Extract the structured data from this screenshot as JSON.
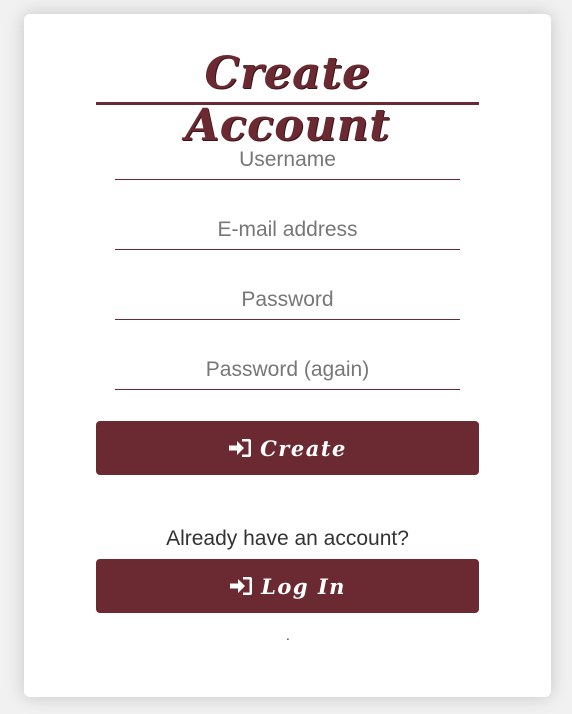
{
  "form": {
    "title": "Create Account",
    "fields": {
      "username": {
        "placeholder": "Username",
        "value": ""
      },
      "email": {
        "placeholder": "E-mail address",
        "value": ""
      },
      "password": {
        "placeholder": "Password",
        "value": ""
      },
      "password_again": {
        "placeholder": "Password (again)",
        "value": ""
      }
    },
    "create_label": "Create",
    "login_prompt": "Already have an account?",
    "login_label": "Log In",
    "footer_dot": "."
  },
  "colors": {
    "accent": "#6b2a31",
    "background": "#f1f1f1",
    "card": "#ffffff"
  },
  "icons": {
    "create": "sign-in-icon",
    "login": "sign-in-icon"
  }
}
